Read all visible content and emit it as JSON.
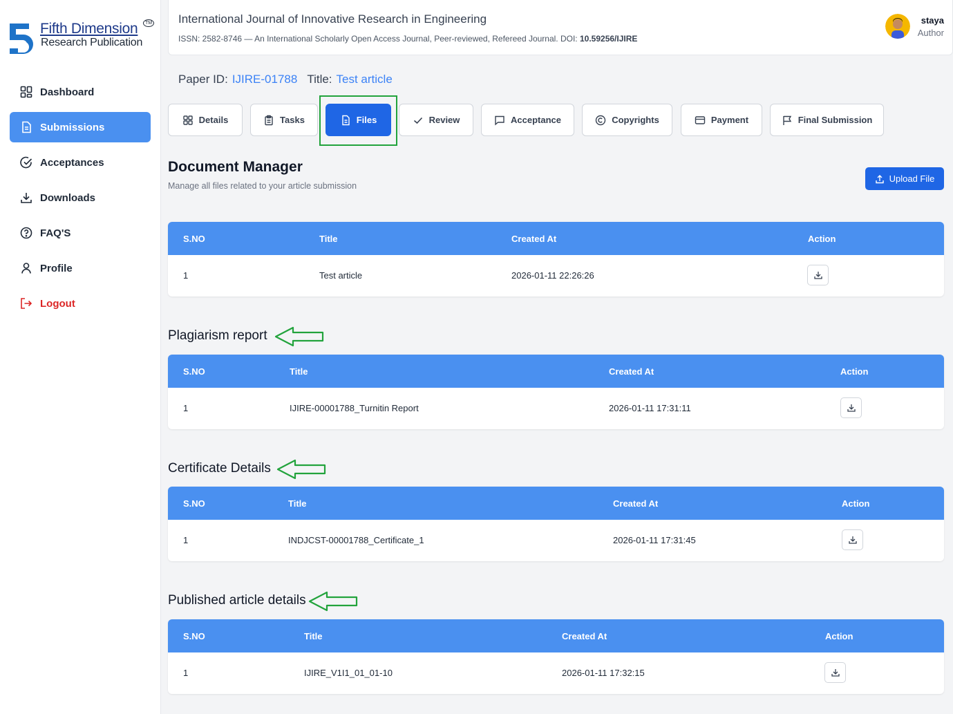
{
  "brand": {
    "line1": "Fifth Dimension",
    "line2": "Research Publication",
    "tm": "TM"
  },
  "sidebar": {
    "items": [
      {
        "label": "Dashboard",
        "icon": "dashboard-grid-icon"
      },
      {
        "label": "Submissions",
        "icon": "document-icon"
      },
      {
        "label": "Acceptances",
        "icon": "check-circle-icon"
      },
      {
        "label": "Downloads",
        "icon": "download-icon"
      },
      {
        "label": "FAQ'S",
        "icon": "help-circle-icon"
      },
      {
        "label": "Profile",
        "icon": "user-icon"
      },
      {
        "label": "Logout",
        "icon": "logout-icon"
      }
    ],
    "active": "Submissions"
  },
  "header": {
    "journal_title": "International Journal of Innovative Research in Engineering",
    "journal_sub": "ISSN: 2582-8746 — An International Scholarly Open Access Journal, Peer-reviewed, Refereed Journal. DOI: ",
    "doi": "10.59256/IJIRE",
    "user_name": "staya",
    "user_role": "Author"
  },
  "paper": {
    "id_label": "Paper ID:",
    "id_value": "IJIRE-01788",
    "title_label": "Title:",
    "title_value": "Test article"
  },
  "tabs": [
    {
      "label": "Details",
      "icon": "grid-icon"
    },
    {
      "label": "Tasks",
      "icon": "clipboard-icon"
    },
    {
      "label": "Files",
      "icon": "file-icon"
    },
    {
      "label": "Review",
      "icon": "check-icon"
    },
    {
      "label": "Acceptance",
      "icon": "message-icon"
    },
    {
      "label": "Copyrights",
      "icon": "copyright-icon"
    },
    {
      "label": "Payment",
      "icon": "credit-card-icon"
    },
    {
      "label": "Final Submission",
      "icon": "flag-icon"
    }
  ],
  "active_tab": "Files",
  "document_manager": {
    "title": "Document Manager",
    "subtitle": "Manage all files related to your article submission",
    "upload_label": "Upload File"
  },
  "tables": [
    {
      "section_title": "",
      "headers": [
        "S.NO",
        "Title",
        "Created At",
        "Action"
      ],
      "rows": [
        {
          "sno": "1",
          "title": "Test article",
          "created_at": "2026-01-11 22:26:26"
        }
      ]
    },
    {
      "section_title": "Plagiarism report",
      "headers": [
        "S.NO",
        "Title",
        "Created At",
        "Action"
      ],
      "rows": [
        {
          "sno": "1",
          "title": "IJIRE-00001788_Turnitin Report",
          "created_at": "2026-01-11 17:31:11"
        }
      ]
    },
    {
      "section_title": "Certificate Details",
      "headers": [
        "S.NO",
        "Title",
        "Created At",
        "Action"
      ],
      "rows": [
        {
          "sno": "1",
          "title": "INDJCST-00001788_Certificate_1",
          "created_at": "2026-01-11 17:31:45"
        }
      ]
    },
    {
      "section_title": "Published article details",
      "headers": [
        "S.NO",
        "Title",
        "Created At",
        "Action"
      ],
      "rows": [
        {
          "sno": "1",
          "title": "IJIRE_V1I1_01_01-10",
          "created_at": "2026-01-11 17:32:15"
        }
      ]
    }
  ],
  "colors": {
    "primary": "#1f66e5",
    "table_header": "#4a90f0",
    "highlight": "#22a33c",
    "logout": "#dc2626"
  }
}
